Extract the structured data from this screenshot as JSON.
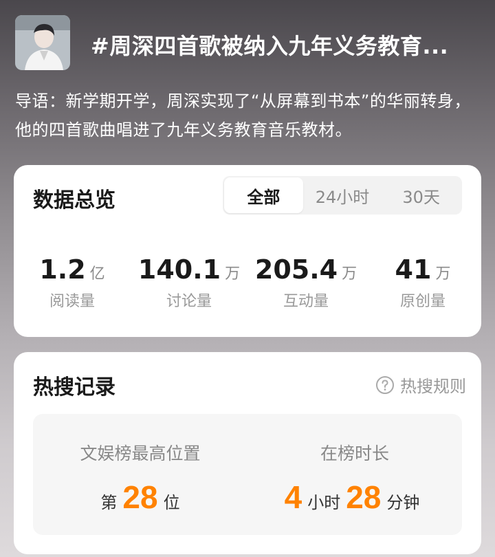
{
  "header": {
    "title": "#周深四首歌被纳入九年义务教育..."
  },
  "intro": {
    "text": "导语：新学期开学，周深实现了“从屏幕到书本”的华丽转身，他的四首歌曲唱进了九年义务教育音乐教材。"
  },
  "overview": {
    "title": "数据总览",
    "tabs": [
      {
        "label": "全部",
        "active": true
      },
      {
        "label": "24小时",
        "active": false
      },
      {
        "label": "30天",
        "active": false
      }
    ],
    "stats": [
      {
        "value": "1.2",
        "unit": "亿",
        "label": "阅读量"
      },
      {
        "value": "140.1",
        "unit": "万",
        "label": "讨论量"
      },
      {
        "value": "205.4",
        "unit": "万",
        "label": "互动量"
      },
      {
        "value": "41",
        "unit": "万",
        "label": "原创量"
      }
    ]
  },
  "hot": {
    "title": "热搜记录",
    "rules_label": "热搜规则",
    "rules_icon": "question-circle-icon",
    "best_position": {
      "label": "文娱榜最高位置",
      "prefix": "第",
      "value": "28",
      "suffix": "位"
    },
    "duration": {
      "label": "在榜时长",
      "hours": "4",
      "hours_unit": "小时",
      "minutes": "28",
      "minutes_unit": "分钟"
    }
  },
  "colors": {
    "accent": "#ff8200",
    "card_bg": "#ffffff",
    "panel_bg": "#f6f6f6"
  }
}
